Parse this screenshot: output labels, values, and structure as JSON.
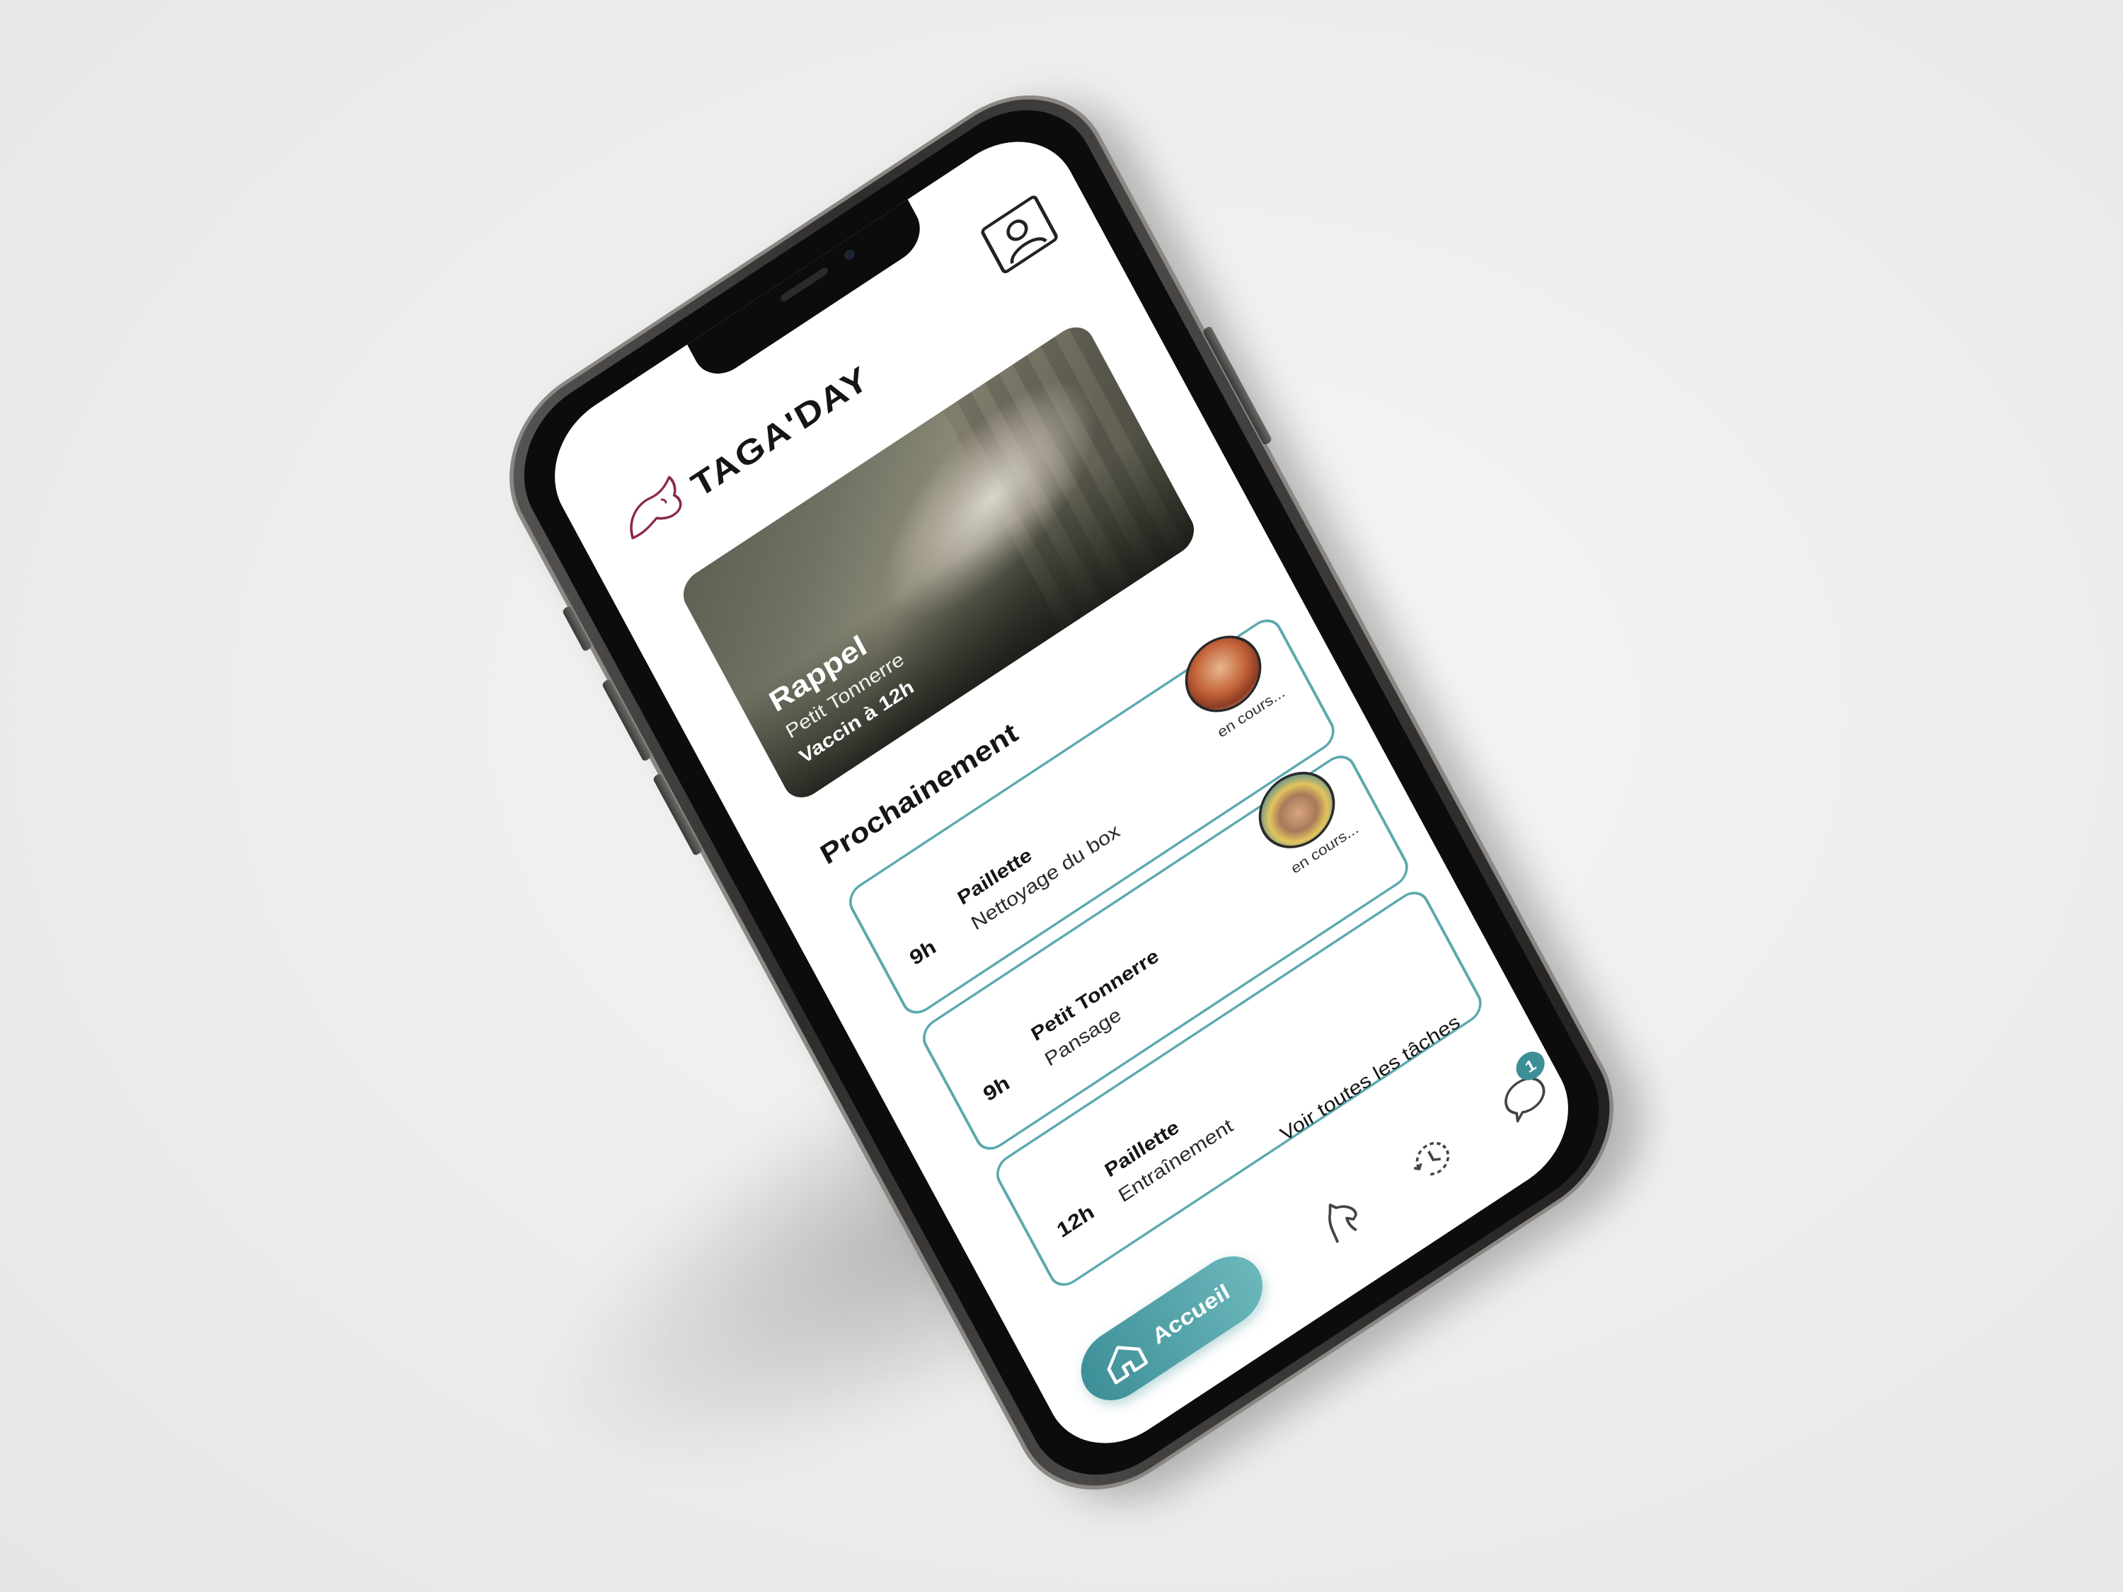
{
  "app": {
    "brand": "TAGA'DAY"
  },
  "reminder": {
    "title": "Rappel",
    "horse": "Petit Tonnerre",
    "detail": "Vaccin à 12h"
  },
  "section_title": "Prochainement",
  "tasks": [
    {
      "time": "9h",
      "horse": "Paillette",
      "name": "Nettoyage du box",
      "status": "en cours..."
    },
    {
      "time": "9h",
      "horse": "Petit Tonnerre",
      "name": "Pansage",
      "status": "en cours..."
    },
    {
      "time": "12h",
      "horse": "Paillette",
      "name": "Entraînement"
    }
  ],
  "see_all_label": "Voir toutes les tâches",
  "nav": {
    "home_label": "Accueil",
    "messages_badge": "1"
  },
  "colors": {
    "accent": "#3d8f97",
    "card_border": "#5aa9ad",
    "logo": "#8b2c46"
  },
  "icons": {
    "profile": "profile-icon",
    "home": "home-icon",
    "horse": "horse-head-icon",
    "history": "clock-history-icon",
    "messages": "chat-bubble-icon"
  }
}
